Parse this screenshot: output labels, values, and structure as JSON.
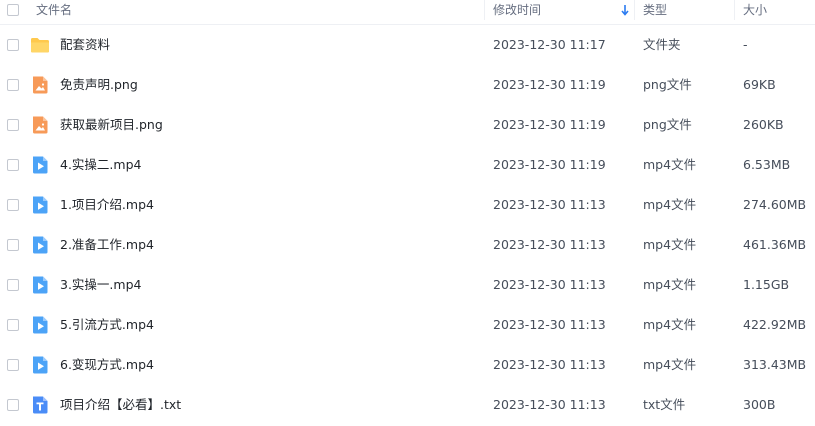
{
  "header": {
    "name_label": "文件名",
    "time_label": "修改时间",
    "type_label": "类型",
    "size_label": "大小",
    "sort_icon": "arrow-down-icon"
  },
  "colors": {
    "folder": "#ffc94d",
    "image": "#f79a58",
    "video": "#4ca3f7",
    "text": "#4a8cf7",
    "sort_arrow": "#2b7bf0"
  },
  "files": [
    {
      "icon": "folder-icon",
      "name": "配套资料",
      "modified": "2023-12-30 11:17",
      "type": "文件夹",
      "size": "-"
    },
    {
      "icon": "image-file-icon",
      "name": "免责声明.png",
      "modified": "2023-12-30 11:19",
      "type": "png文件",
      "size": "69KB"
    },
    {
      "icon": "image-file-icon",
      "name": "获取最新项目.png",
      "modified": "2023-12-30 11:19",
      "type": "png文件",
      "size": "260KB"
    },
    {
      "icon": "video-file-icon",
      "name": "4.实操二.mp4",
      "modified": "2023-12-30 11:19",
      "type": "mp4文件",
      "size": "6.53MB"
    },
    {
      "icon": "video-file-icon",
      "name": "1.项目介绍.mp4",
      "modified": "2023-12-30 11:13",
      "type": "mp4文件",
      "size": "274.60MB"
    },
    {
      "icon": "video-file-icon",
      "name": "2.准备工作.mp4",
      "modified": "2023-12-30 11:13",
      "type": "mp4文件",
      "size": "461.36MB"
    },
    {
      "icon": "video-file-icon",
      "name": "3.实操一.mp4",
      "modified": "2023-12-30 11:13",
      "type": "mp4文件",
      "size": "1.15GB"
    },
    {
      "icon": "video-file-icon",
      "name": "5.引流方式.mp4",
      "modified": "2023-12-30 11:13",
      "type": "mp4文件",
      "size": "422.92MB"
    },
    {
      "icon": "video-file-icon",
      "name": "6.变现方式.mp4",
      "modified": "2023-12-30 11:13",
      "type": "mp4文件",
      "size": "313.43MB"
    },
    {
      "icon": "text-file-icon",
      "name": "项目介绍【必看】.txt",
      "modified": "2023-12-30 11:13",
      "type": "txt文件",
      "size": "300B"
    }
  ]
}
